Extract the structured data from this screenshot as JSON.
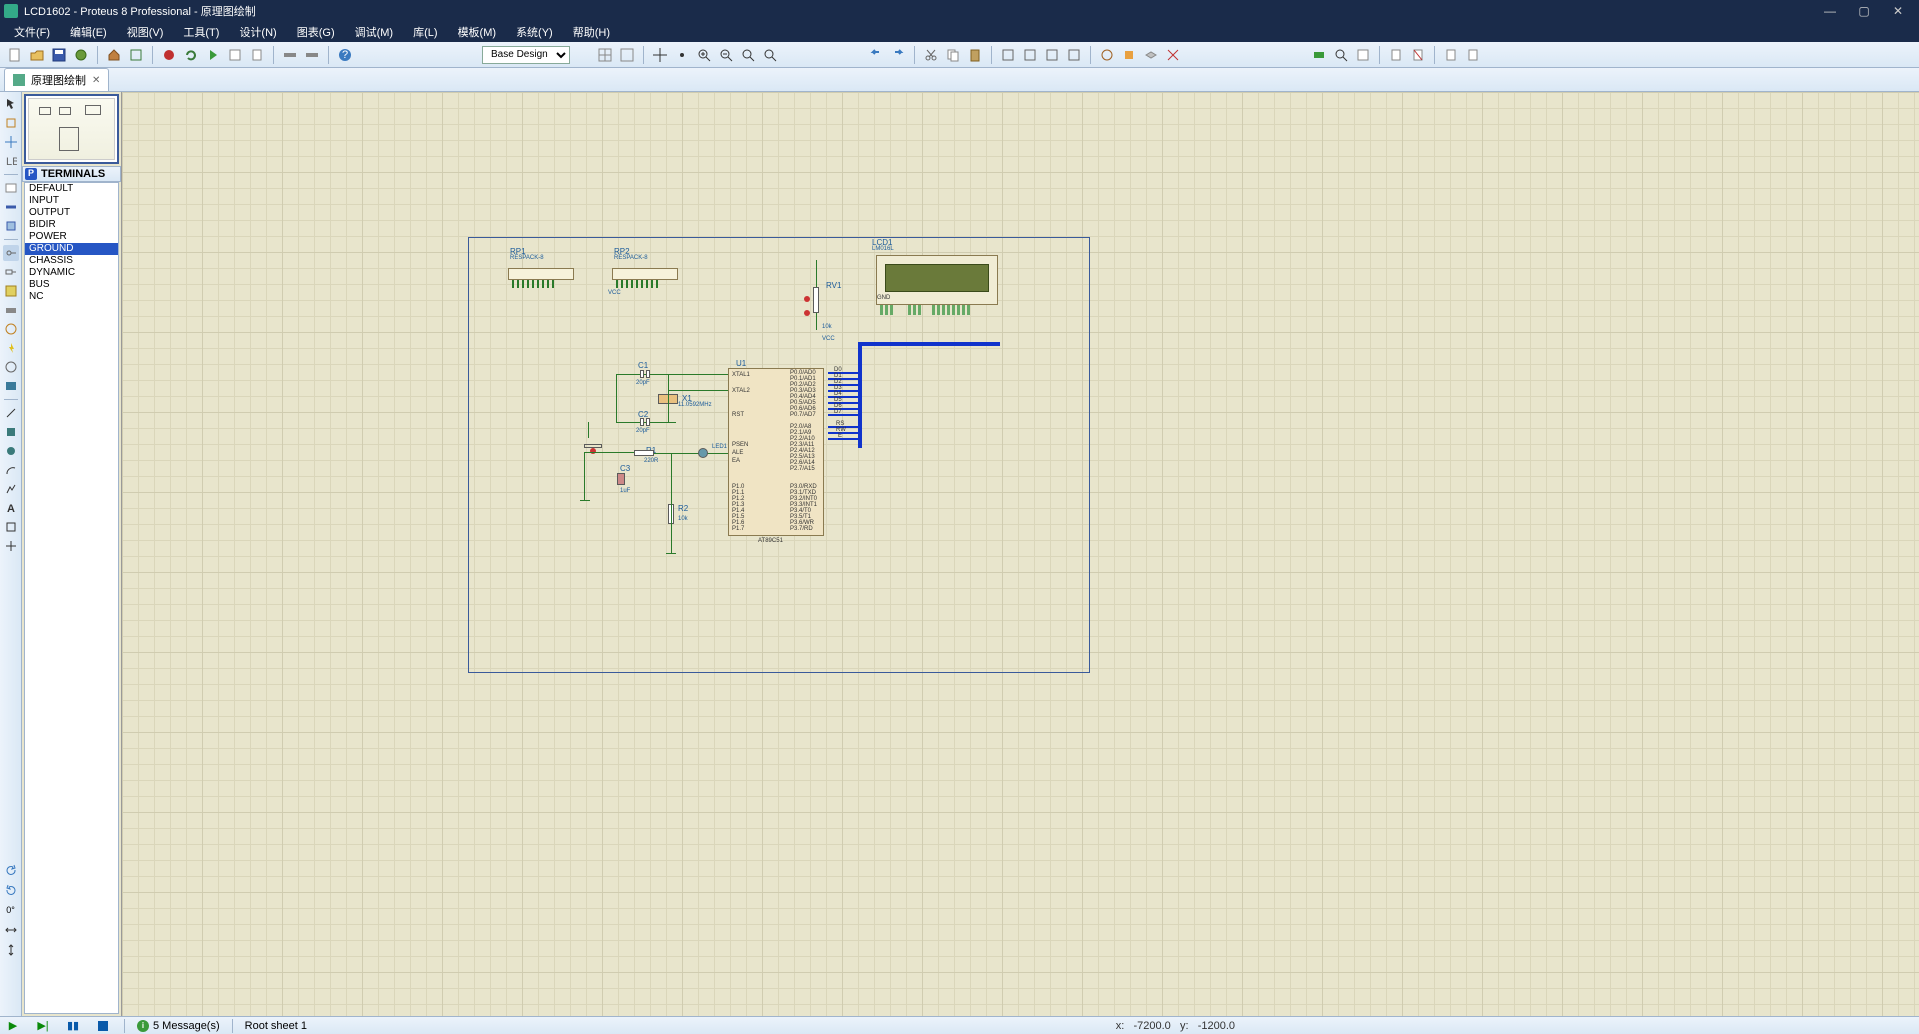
{
  "title": "LCD1602 - Proteus 8 Professional - 原理图绘制",
  "menu": {
    "file": "文件(F)",
    "edit": "编辑(E)",
    "view": "视图(V)",
    "tools": "工具(T)",
    "design": "设计(N)",
    "chart": "图表(G)",
    "debug": "调试(M)",
    "library": "库(L)",
    "template": "模板(M)",
    "system": "系统(Y)",
    "help": "帮助(H)"
  },
  "toolbar": {
    "design_combo": "Base Design"
  },
  "tab": {
    "label": "原理图绘制"
  },
  "terminals": {
    "header": "TERMINALS",
    "header_icon": "P",
    "items": [
      "DEFAULT",
      "INPUT",
      "OUTPUT",
      "BIDIR",
      "POWER",
      "GROUND",
      "CHASSIS",
      "DYNAMIC",
      "BUS",
      "NC"
    ],
    "selected": "GROUND"
  },
  "components": {
    "rp1": {
      "name": "RP1",
      "type": "RESPACK-8"
    },
    "rp2": {
      "name": "RP2",
      "type": "RESPACK-8"
    },
    "lcd": {
      "name": "LCD1",
      "type": "LM016L"
    },
    "rv1": {
      "name": "RV1",
      "value": "10k"
    },
    "u1": {
      "name": "U1",
      "type": "AT89C51"
    },
    "c1": {
      "name": "C1",
      "value": "20pF"
    },
    "c2": {
      "name": "C2",
      "value": "20pF"
    },
    "c3": {
      "name": "C3",
      "value": "1uF"
    },
    "x1": {
      "name": "X1",
      "value": "11.0592MHz"
    },
    "r1": {
      "name": "R1",
      "value": "220R"
    },
    "r2": {
      "name": "R2",
      "value": "10k"
    },
    "led1": {
      "name": "LED1"
    },
    "vcc": {
      "name": "VCC"
    },
    "pins_u1_left": [
      "XTAL1",
      "XTAL2",
      "RST",
      "PSEN",
      "ALE",
      "EA"
    ],
    "pins_u1_p0": [
      "P0.0/AD0",
      "P0.1/AD1",
      "P0.2/AD2",
      "P0.3/AD3",
      "P0.4/AD4",
      "P0.5/AD5",
      "P0.6/AD6",
      "P0.7/AD7"
    ],
    "pins_u1_p2": [
      "P2.0/A8",
      "P2.1/A9",
      "P2.2/A10",
      "P2.3/A11",
      "P2.4/A12",
      "P2.5/A13",
      "P2.6/A14",
      "P2.7/A15"
    ],
    "pins_u1_p1": [
      "P1.0",
      "P1.1",
      "P1.2",
      "P1.3",
      "P1.4",
      "P1.5",
      "P1.6",
      "P1.7"
    ],
    "pins_u1_p3": [
      "P3.0/RXD",
      "P3.1/TXD",
      "P3.2/INT0",
      "P3.3/INT1",
      "P3.4/T0",
      "P3.5/T1",
      "P3.6/WR",
      "P3.7/RD"
    ],
    "lcd_data_labels": [
      "D0",
      "D1",
      "D2",
      "D3",
      "D4",
      "D5",
      "D6",
      "D7"
    ],
    "lcd_ctrl_labels": [
      "RS",
      "RW",
      "E"
    ]
  },
  "status": {
    "messages": "5 Message(s)",
    "sheet": "Root sheet 1",
    "coords_x_label": "x:",
    "coords_x": "-7200.0",
    "coords_y_label": "y:",
    "coords_y": "-1200.0"
  }
}
